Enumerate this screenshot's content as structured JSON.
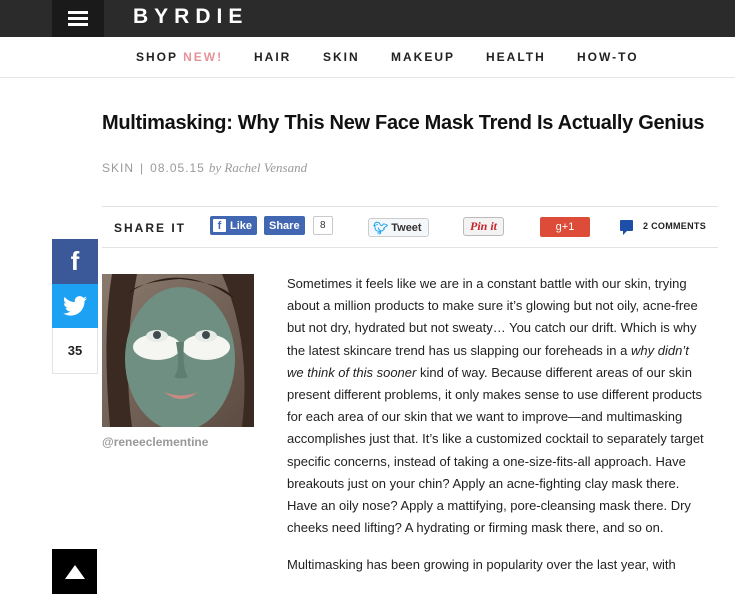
{
  "header": {
    "logo": "BYRDIE",
    "menu_icon": "hamburger-icon"
  },
  "nav": {
    "shop_label": "SHOP",
    "shop_new": "NEW!",
    "items": [
      "HAIR",
      "SKIN",
      "MAKEUP",
      "HEALTH",
      "HOW-TO"
    ]
  },
  "article": {
    "title": "Multimasking: Why This New Face Mask Trend Is Actually Genius",
    "category": "SKIN",
    "date": "08.05.15",
    "byline_prefix": "by",
    "author": "Rachel Vensand",
    "image_credit": "@reneeclementine",
    "p1_a": "Sometimes it feels like we are in a constant battle with our skin, trying about a million products to make sure it’s glowing but not oily, acne-free but not dry, hydrated but not sweaty… You catch our drift. Which is why the latest skincare trend has us slapping our foreheads in a ",
    "p1_em": "why didn’t we think of this sooner",
    "p1_b": " kind of way. Because different areas of our skin present different problems, it only makes sense to use different products for each area of our skin that we want to improve—and multimasking accomplishes just that. It’s like a customized cocktail to separately target specific concerns, instead of taking a one-size-fits-all approach. Have breakouts just on your chin? Apply an acne-fighting clay mask there. Have an oily nose? Apply a mattifying, pore-cleansing mask there. Dry cheeks need lifting? A hydrating or firming mask there, and so on.",
    "p2": "Multimasking has been growing in popularity over the last year, with"
  },
  "share": {
    "label": "SHARE IT",
    "fb_like": "Like",
    "fb_share": "Share",
    "fb_count": "8",
    "tweet": "Tweet",
    "pinit": "Pin it",
    "gplus": "g+1",
    "comments": "2 COMMENTS"
  },
  "rail": {
    "count": "35"
  },
  "colors": {
    "topbar": "#2b2b2b",
    "accent_new": "#e59399",
    "facebook": "#3b5998",
    "twitter": "#1da1f2",
    "gplus": "#dd4b39"
  }
}
